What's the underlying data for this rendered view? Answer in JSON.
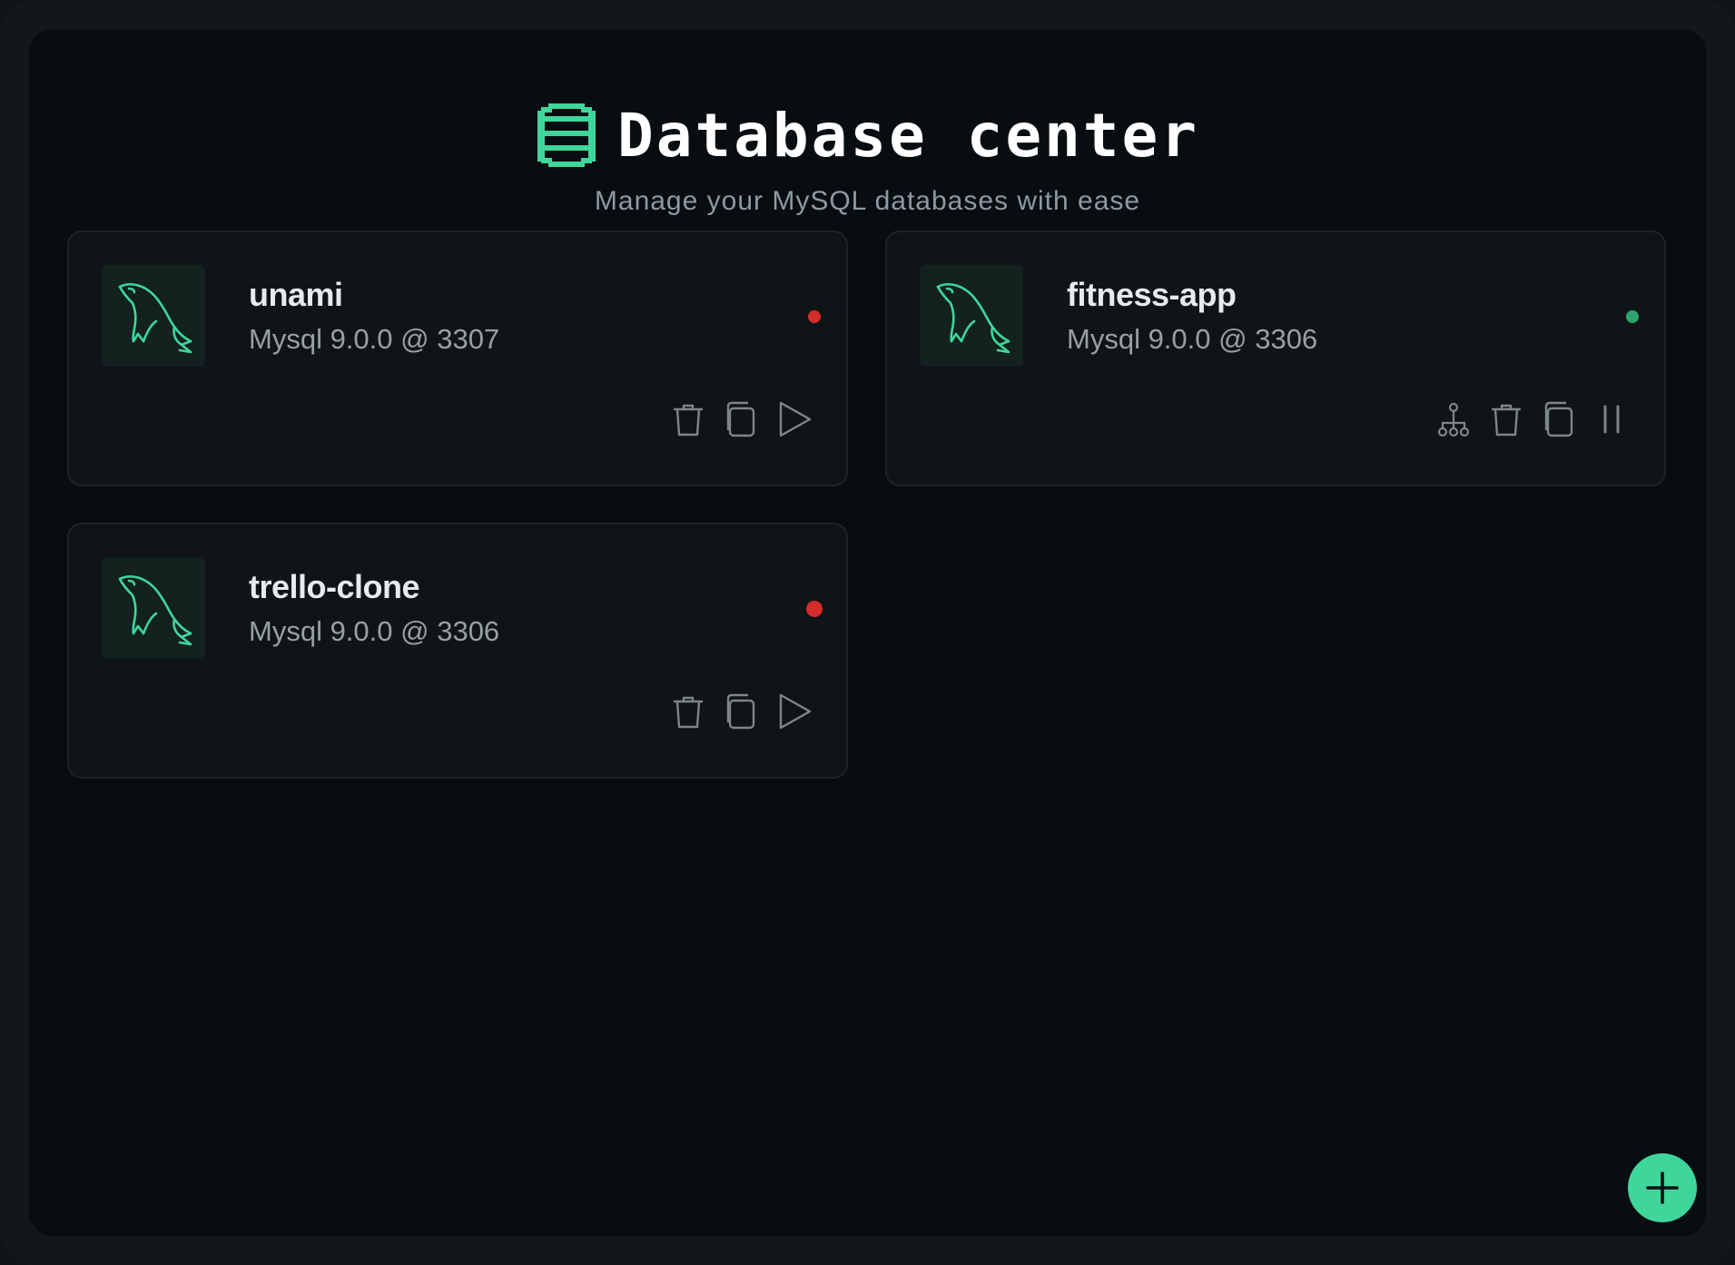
{
  "header": {
    "title": "Database center",
    "subtitle": "Manage your MySQL databases with ease",
    "icon": "database-icon"
  },
  "colors": {
    "accent": "#3fd69b",
    "status_running": "#2ea36b",
    "status_stopped": "#d42b2b",
    "icon_gray": "#7d868c"
  },
  "databases": [
    {
      "name": "unami",
      "meta": "Mysql 9.0.0 @ 3307",
      "status": "stopped",
      "actions": [
        "trash-icon",
        "copy-icon",
        "play-icon"
      ]
    },
    {
      "name": "fitness-app",
      "meta": "Mysql 9.0.0 @ 3306",
      "status": "running",
      "actions": [
        "network-icon",
        "trash-icon",
        "copy-icon",
        "pause-icon"
      ]
    },
    {
      "name": "trello-clone",
      "meta": "Mysql 9.0.0 @ 3306",
      "status": "stopped",
      "actions": [
        "trash-icon",
        "copy-icon",
        "play-icon"
      ]
    }
  ],
  "fab": {
    "icon": "plus-icon"
  }
}
